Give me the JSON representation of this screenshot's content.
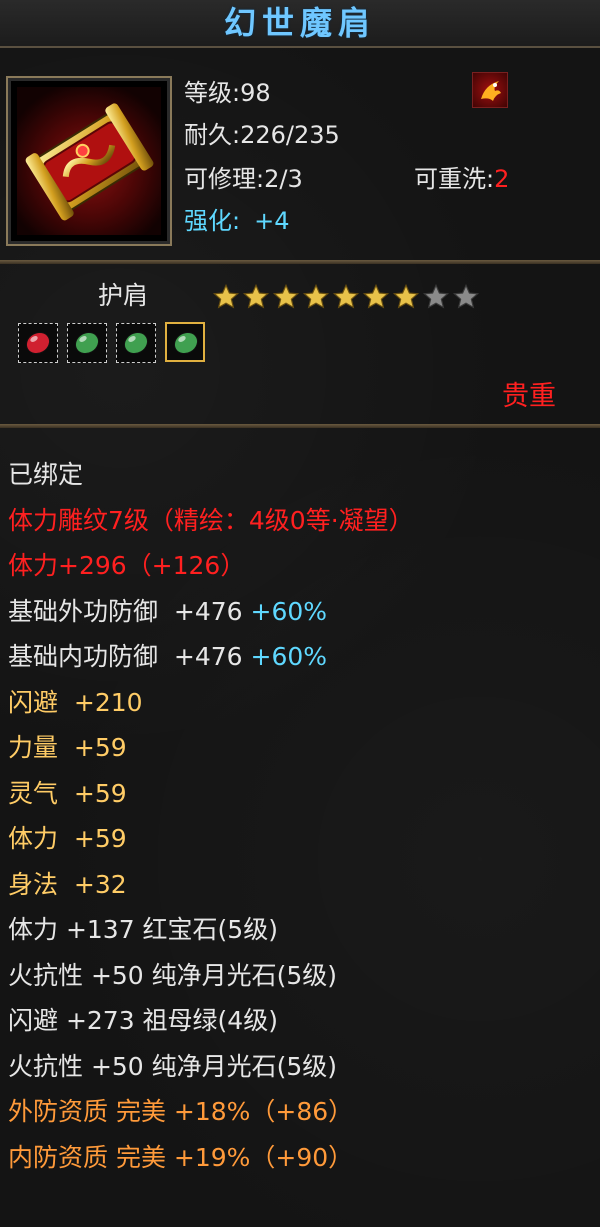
{
  "item": {
    "name": "幻世魔肩",
    "level_label": "等级:98",
    "durability_label": "耐久:226/235",
    "repair_label": "可修理:2/3",
    "rewash_label": "可重洗:",
    "rewash_value": "2",
    "enhance_label": "强化:",
    "enhance_value": "+4",
    "type_label": "护肩",
    "stars": {
      "filled": 7,
      "total": 9
    },
    "rarity_label": "贵重",
    "gems": [
      {
        "icon": "ruby-gem-icon",
        "color": "#d02030"
      },
      {
        "icon": "jade-gem-icon",
        "color": "#40a050"
      },
      {
        "icon": "jade-gem-icon",
        "color": "#40a050"
      },
      {
        "icon": "jade-gem-icon",
        "color": "#40a050"
      }
    ],
    "item_icon": "shoulder-armor-icon",
    "badge_icon": "dragon-badge-icon"
  },
  "attributes": {
    "bound": "已绑定",
    "engrave": "体力雕纹7级（精绘：4级0等·凝望）",
    "engrave_bonus": "体力+296（+126）",
    "rows": [
      {
        "name": "基础外功防御",
        "value": "  +476",
        "extra": " +60%"
      },
      {
        "name": "基础内功防御",
        "value": "  +476",
        "extra": " +60%"
      },
      {
        "name": "闪避",
        "value": "  +210"
      },
      {
        "name": "力量",
        "value": "  +59"
      },
      {
        "name": "灵气",
        "value": "  +59"
      },
      {
        "name": "体力",
        "value": "  +59"
      },
      {
        "name": "身法",
        "value": "  +32"
      }
    ],
    "gem_rows": [
      {
        "text": "体力 +137 红宝石(5级)"
      },
      {
        "text": "火抗性 +50 纯净月光石(5级)"
      },
      {
        "text": "闪避 +273 祖母绿(4级)"
      },
      {
        "text": "火抗性 +50 纯净月光石(5级)"
      }
    ],
    "quality_rows": [
      {
        "text": "外防资质  完美 +18%（+86）"
      },
      {
        "text": "内防资质  完美 +19%（+90）"
      }
    ]
  },
  "colors": {
    "title": "#6fc7ff",
    "red": "#ff2020",
    "cyan": "#5fd8ff",
    "orange": "#ff9a3a",
    "gold_attr": "#ffcc66",
    "white": "#e6e6e6"
  }
}
